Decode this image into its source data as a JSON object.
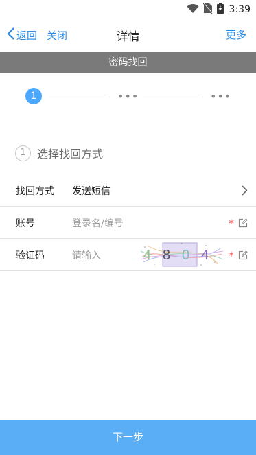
{
  "status_bar": {
    "time": "3:39"
  },
  "nav": {
    "back_label": "返回",
    "close_label": "关闭",
    "title": "详情",
    "more_label": "更多"
  },
  "section": {
    "title": "密码找回"
  },
  "steps": {
    "current": "1",
    "pending_dots": [
      "•••",
      "•••"
    ]
  },
  "method": {
    "number": "1",
    "title": "选择找回方式"
  },
  "form": {
    "rows": [
      {
        "label": "找回方式",
        "value": "发送短信"
      },
      {
        "label": "账号",
        "placeholder": "登录名/编号",
        "required": "*"
      },
      {
        "label": "验证码",
        "placeholder": "请输入",
        "required": "*",
        "captcha": "4804"
      }
    ]
  },
  "footer": {
    "next_label": "下一步"
  },
  "colors": {
    "accent": "#2a8be8",
    "step_active": "#4aa8ff",
    "button": "#5aaef5",
    "required": "#ff4d4f",
    "section_bar": "#7a7a7a"
  }
}
